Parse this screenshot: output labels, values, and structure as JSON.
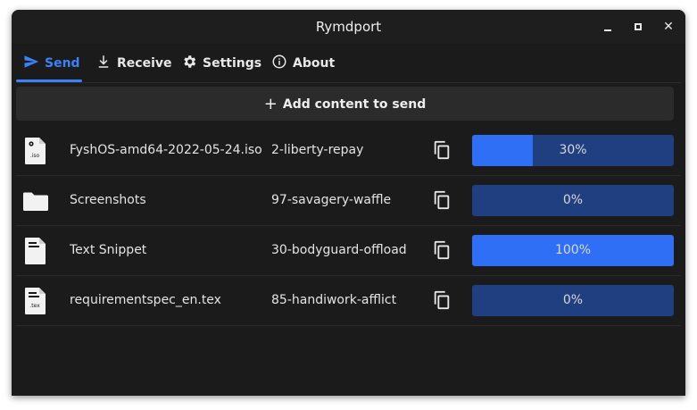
{
  "window": {
    "title": "Rymdport",
    "close_glyph": "✕"
  },
  "tabs": [
    {
      "label": "Send",
      "icon": "send-icon",
      "active": true
    },
    {
      "label": "Receive",
      "icon": "download-icon",
      "active": false
    },
    {
      "label": "Settings",
      "icon": "gear-icon",
      "active": false
    },
    {
      "label": "About",
      "icon": "info-icon",
      "active": false
    }
  ],
  "add_button": {
    "label": "Add content to send",
    "icon": "plus-icon"
  },
  "items": [
    {
      "name": "FyshOS-amd64-2022-05-24.iso",
      "code": "2-liberty-repay",
      "progress": 30,
      "progress_label": "30%",
      "icon": "iso-file-icon",
      "ext": ".iso"
    },
    {
      "name": "Screenshots",
      "code": "97-savagery-waffle",
      "progress": 0,
      "progress_label": "0%",
      "icon": "folder-icon",
      "ext": ""
    },
    {
      "name": "Text Snippet",
      "code": "30-bodyguard-offload",
      "progress": 100,
      "progress_label": "100%",
      "icon": "text-file-icon",
      "ext": ""
    },
    {
      "name": "requirementspec_en.tex",
      "code": "85-handiwork-afflict",
      "progress": 0,
      "progress_label": "0%",
      "icon": "tex-file-icon",
      "ext": ".tex"
    }
  ],
  "colors": {
    "accent": "#3b82f6",
    "progress_fill": "#2f6ff5",
    "progress_track": "#1f3f80",
    "background": "#1b1b1b"
  }
}
